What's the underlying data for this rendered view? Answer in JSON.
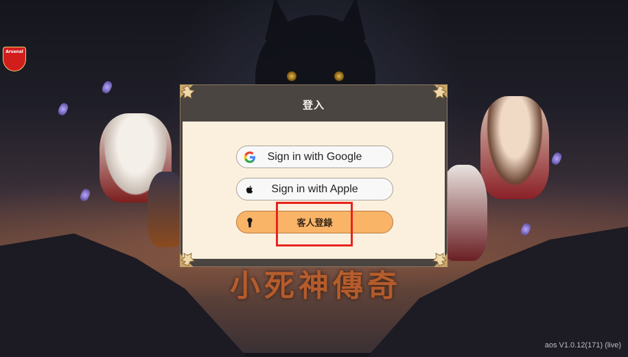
{
  "dialog": {
    "title": "登入",
    "google_label": "Sign in with Google",
    "apple_label": "Sign in with Apple",
    "guest_label": "客人登錄"
  },
  "background": {
    "crest_text": "Arsenal",
    "logo_text": "小死神傳奇"
  },
  "footer": {
    "version": "aos V1.0.12(171) (live)"
  },
  "colors": {
    "dialog_bg": "#fbf0de",
    "header_bg": "#4b4542",
    "guest_button": "#f9b468",
    "highlight_box": "#e8221e"
  },
  "icons": {
    "google": "google-g-icon",
    "apple": "apple-logo-icon",
    "guest": "keyhole-person-icon"
  }
}
